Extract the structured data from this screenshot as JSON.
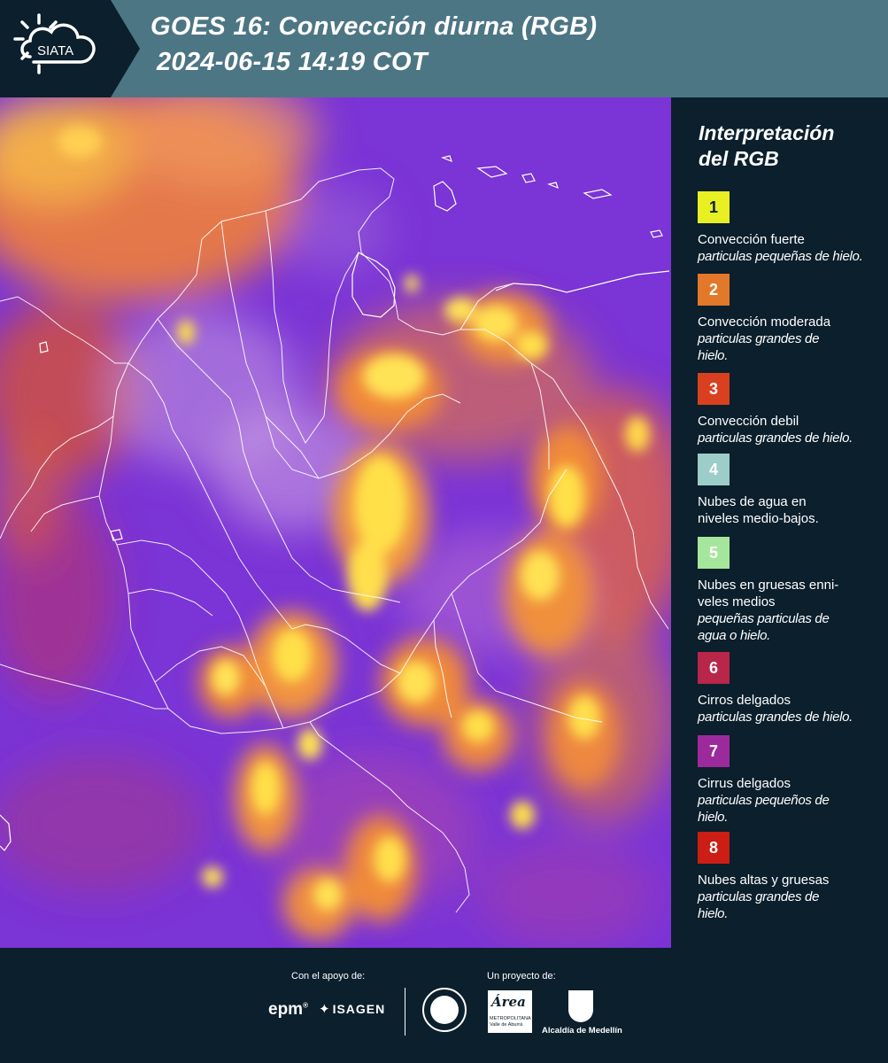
{
  "header": {
    "logo_text": "SIATA",
    "title": "GOES 16: Convección diurna (RGB)",
    "timestamp": "2024-06-15 14:19 COT"
  },
  "legend": {
    "title_line1": "Interpretación",
    "title_line2": "del RGB",
    "items": [
      {
        "number": "1",
        "color": "#e8ef23",
        "text_color": "#0b1f2c",
        "label": "Convección fuerte",
        "detail": "particulas pequeñas de hielo."
      },
      {
        "number": "2",
        "color": "#e2782a",
        "text_color": "#ffffff",
        "label": "Convección moderada",
        "detail": "particulas grandes de hielo."
      },
      {
        "number": "3",
        "color": "#d9401f",
        "text_color": "#ffffff",
        "label": "Convección debil",
        "detail": "particulas grandes de hielo."
      },
      {
        "number": "4",
        "color": "#9ccdc9",
        "text_color": "#ffffff",
        "label": "Nubes de agua en niveles medio-bajos.",
        "detail": ""
      },
      {
        "number": "5",
        "color": "#a6e69c",
        "text_color": "#ffffff",
        "label": "Nubes en gruesas enni- veles medios",
        "detail": "pequeñas particulas de agua o hielo."
      },
      {
        "number": "6",
        "color": "#b8264a",
        "text_color": "#ffffff",
        "label": "Cirros delgados",
        "detail": "particulas grandes de hielo."
      },
      {
        "number": "7",
        "color": "#9c2a9c",
        "text_color": "#ffffff",
        "label": "Cirrus delgados",
        "detail": "particulas pequeños de hielo."
      },
      {
        "number": "8",
        "color": "#cc1e14",
        "text_color": "#ffffff",
        "label": "Nubes altas y gruesas",
        "detail": "particulas grandes de hielo."
      }
    ]
  },
  "footer": {
    "support_label": "Con el apoyo de:",
    "project_label": "Un proyecto de:",
    "epm": "epm",
    "epm_reg": "®",
    "isagen": "ISAGEN",
    "area_word": "Área",
    "area_sub1": "METROPOLITANA",
    "area_sub2": "Valle de Aburrá",
    "alcaldia": "Alcaldía de Medellín"
  },
  "map_colors": {
    "base": "#7b34d6",
    "convection_strong": "#ffe04a",
    "convection_moderate": "#f08a3a",
    "thin_cirrus": "#c06ac8",
    "borders": "#ffffff"
  }
}
